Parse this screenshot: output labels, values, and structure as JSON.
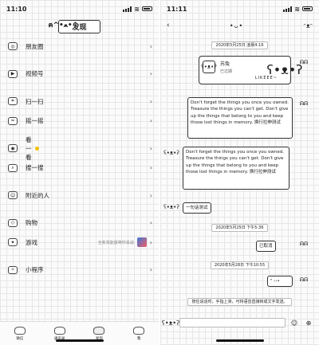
{
  "left": {
    "status": {
      "time": "11:10"
    },
    "header": {
      "title": "发现"
    },
    "menu": [
      {
        "label": "朋友圈",
        "icon": "moments-icon",
        "glyph": "◎"
      },
      {
        "label": "视频号",
        "icon": "channels-icon",
        "glyph": "▶"
      },
      {
        "label": "扫一扫",
        "icon": "scan-icon",
        "glyph": "⌗"
      },
      {
        "label": "摇一摇",
        "icon": "shake-icon",
        "glyph": "≈"
      },
      {
        "label": "看一看",
        "icon": "top-stories-icon",
        "glyph": "◉"
      },
      {
        "label": "搜一搜",
        "icon": "search-icon",
        "glyph": "⌕"
      },
      {
        "label": "附近的人",
        "icon": "nearby-icon",
        "glyph": "☺"
      },
      {
        "label": "购物",
        "icon": "shopping-icon",
        "glyph": "◇"
      },
      {
        "label": "游戏",
        "icon": "games-icon",
        "glyph": "✦",
        "extra": "全新高能版等你来战"
      },
      {
        "label": "小程序",
        "icon": "mini-programs-icon",
        "glyph": "✧"
      }
    ],
    "tabs": [
      {
        "label": "微信"
      },
      {
        "label": "通讯录"
      },
      {
        "label": "发现"
      },
      {
        "label": "我"
      }
    ]
  },
  "right": {
    "status": {
      "time": "11:11"
    },
    "header": {
      "face": "•ᴗ•"
    },
    "timestamps": {
      "t1": "2020年5月25日 凌晨4:16",
      "t2": "2020年5月25日 下午5:36",
      "t3": "2020年5月28日 下午10:55"
    },
    "card": {
      "name": "苏兔",
      "sub": "已过期",
      "brand": "LIKEEE~"
    },
    "messages": {
      "m1": "Don't forget the things you once you owned. Treasure the things you can't get. Don't give up the things that belong to you and keep those lost things in memory. 换行拉伸测试",
      "m2": "Don't forget the things you once you owned. Treasure the things you can't get. Don't give up the things that belong to you and keep those lost things in memory. 换行拉伸测试",
      "m3": "一句话测试",
      "m4": "已取消",
      "m5": "\" ‹‹•"
    },
    "voice_hint": "按住说话时，手指上滑，可将语音直接转成文字发送。"
  }
}
